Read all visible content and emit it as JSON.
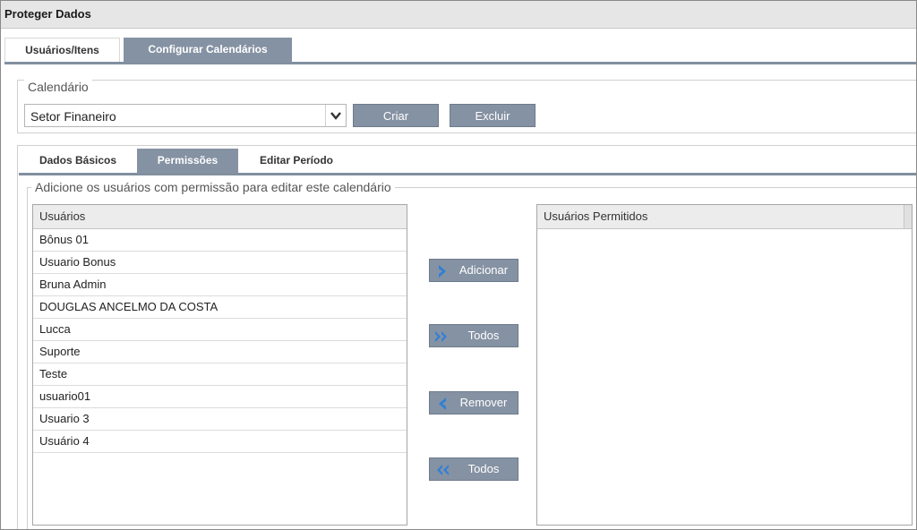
{
  "window": {
    "title": "Proteger Dados"
  },
  "main_tabs": [
    {
      "label": "Usuários/Itens",
      "active": false
    },
    {
      "label": "Configurar Calendários",
      "active": true
    }
  ],
  "calendar": {
    "legend": "Calendário",
    "selected": "Setor Finaneiro",
    "create_label": "Criar",
    "delete_label": "Excluir"
  },
  "sub_tabs": [
    {
      "label": "Dados Básicos",
      "active": false
    },
    {
      "label": "Permissões",
      "active": true
    },
    {
      "label": "Editar Período",
      "active": false
    }
  ],
  "permissions": {
    "legend": "Adicione os usuários com permissão para editar este calendário",
    "users_header": "Usuários",
    "users": [
      "Bônus 01",
      "Usuario Bonus",
      "Bruna Admin",
      "DOUGLAS ANCELMO DA COSTA",
      "Lucca",
      "Suporte",
      "Teste",
      "usuario01",
      "Usuario 3",
      "Usuário 4"
    ],
    "allowed_header": "Usuários Permitidos",
    "allowed": [],
    "buttons": {
      "add": "Adicionar",
      "add_all": "Todos",
      "remove": "Remover",
      "remove_all": "Todos"
    }
  },
  "colors": {
    "accent": "#8592a3",
    "icon_blue": "#2f7fd6"
  }
}
